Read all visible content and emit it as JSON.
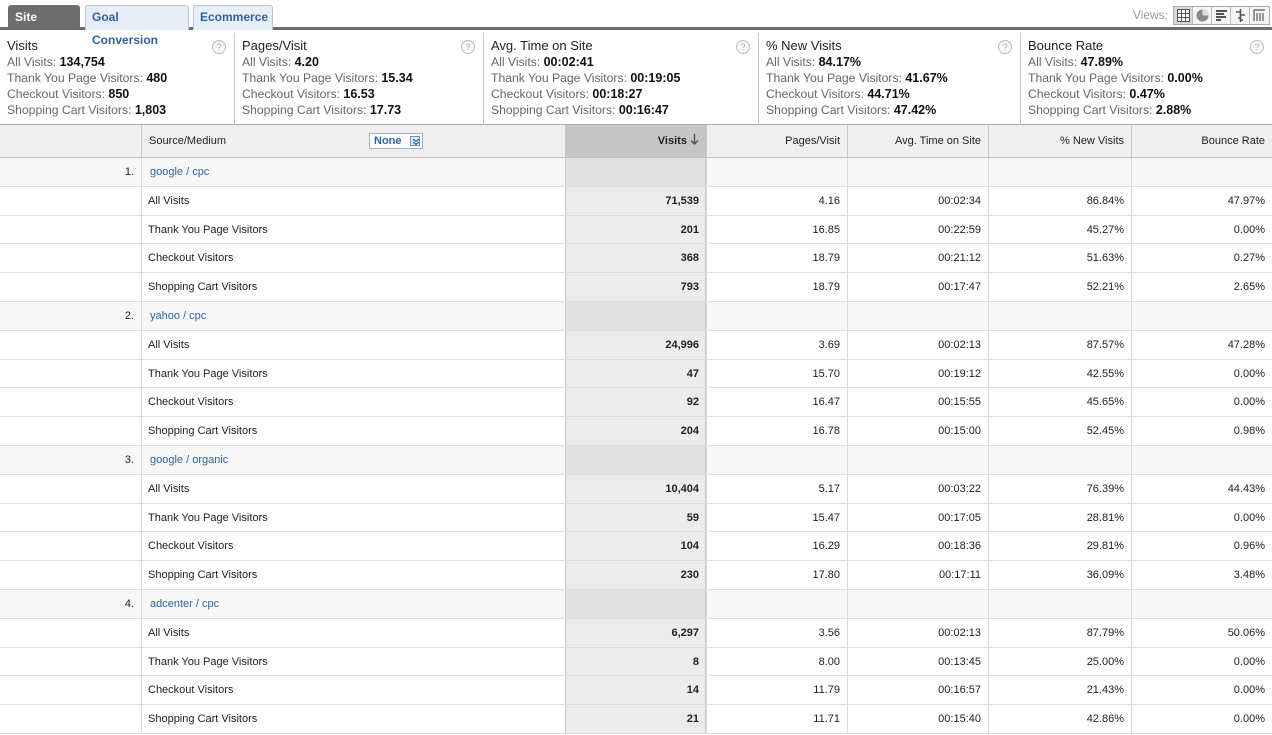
{
  "tabs": [
    "Site Usage",
    "Goal Conversion",
    "Ecommerce"
  ],
  "views_label": "Views:",
  "view_icons": [
    "table-view-icon",
    "pie-view-icon",
    "performance-view-icon",
    "comparison-view-icon",
    "pivot-view-icon"
  ],
  "summary": [
    {
      "title": "Visits",
      "lines": [
        [
          "All Visits:",
          "134,754"
        ],
        [
          "Thank You Page Visitors:",
          "480"
        ],
        [
          "Checkout Visitors:",
          "850"
        ],
        [
          "Shopping Cart Visitors:",
          "1,803"
        ]
      ]
    },
    {
      "title": "Pages/Visit",
      "lines": [
        [
          "All Visits:",
          "4.20"
        ],
        [
          "Thank You Page Visitors:",
          "15.34"
        ],
        [
          "Checkout Visitors:",
          "16.53"
        ],
        [
          "Shopping Cart Visitors:",
          "17.73"
        ]
      ]
    },
    {
      "title": "Avg. Time on Site",
      "lines": [
        [
          "All Visits:",
          "00:02:41"
        ],
        [
          "Thank You Page Visitors:",
          "00:19:05"
        ],
        [
          "Checkout Visitors:",
          "00:18:27"
        ],
        [
          "Shopping Cart Visitors:",
          "00:16:47"
        ]
      ]
    },
    {
      "title": "% New Visits",
      "lines": [
        [
          "All Visits:",
          "84.17%"
        ],
        [
          "Thank You Page Visitors:",
          "41.67%"
        ],
        [
          "Checkout Visitors:",
          "44.71%"
        ],
        [
          "Shopping Cart Visitors:",
          "47.42%"
        ]
      ]
    },
    {
      "title": "Bounce Rate",
      "lines": [
        [
          "All Visits:",
          "47.89%"
        ],
        [
          "Thank You Page Visitors:",
          "0.00%"
        ],
        [
          "Checkout Visitors:",
          "0.47%"
        ],
        [
          "Shopping Cart Visitors:",
          "2.88%"
        ]
      ]
    }
  ],
  "help_glyph": "?",
  "table": {
    "headers": {
      "source": "Source/Medium",
      "segment": "None",
      "visits": "Visits",
      "pages": "Pages/Visit",
      "time": "Avg. Time on Site",
      "newv": "% New Visits",
      "bounce": "Bounce Rate"
    },
    "groups": [
      {
        "rank": "1.",
        "name": "google / cpc",
        "rows": [
          [
            "All Visits",
            "71,539",
            "4.16",
            "00:02:34",
            "86.84%",
            "47.97%"
          ],
          [
            "Thank You Page Visitors",
            "201",
            "16.85",
            "00:22:59",
            "45.27%",
            "0.00%"
          ],
          [
            "Checkout Visitors",
            "368",
            "18.79",
            "00:21:12",
            "51.63%",
            "0.27%"
          ],
          [
            "Shopping Cart Visitors",
            "793",
            "18.79",
            "00:17:47",
            "52.21%",
            "2.65%"
          ]
        ]
      },
      {
        "rank": "2.",
        "name": "yahoo / cpc",
        "rows": [
          [
            "All Visits",
            "24,996",
            "3.69",
            "00:02:13",
            "87.57%",
            "47.28%"
          ],
          [
            "Thank You Page Visitors",
            "47",
            "15.70",
            "00:19:12",
            "42.55%",
            "0.00%"
          ],
          [
            "Checkout Visitors",
            "92",
            "16.47",
            "00:15:55",
            "45.65%",
            "0.00%"
          ],
          [
            "Shopping Cart Visitors",
            "204",
            "16.78",
            "00:15:00",
            "52.45%",
            "0.98%"
          ]
        ]
      },
      {
        "rank": "3.",
        "name": "google / organic",
        "rows": [
          [
            "All Visits",
            "10,404",
            "5.17",
            "00:03:22",
            "76.39%",
            "44.43%"
          ],
          [
            "Thank You Page Visitors",
            "59",
            "15.47",
            "00:17:05",
            "28.81%",
            "0.00%"
          ],
          [
            "Checkout Visitors",
            "104",
            "16.29",
            "00:18:36",
            "29.81%",
            "0.96%"
          ],
          [
            "Shopping Cart Visitors",
            "230",
            "17.80",
            "00:17:11",
            "36.09%",
            "3.48%"
          ]
        ]
      },
      {
        "rank": "4.",
        "name": "adcenter / cpc",
        "rows": [
          [
            "All Visits",
            "6,297",
            "3.56",
            "00:02:13",
            "87.79%",
            "50.06%"
          ],
          [
            "Thank You Page Visitors",
            "8",
            "8.00",
            "00:13:45",
            "25.00%",
            "0.00%"
          ],
          [
            "Checkout Visitors",
            "14",
            "11.79",
            "00:16:57",
            "21.43%",
            "0.00%"
          ],
          [
            "Shopping Cart Visitors",
            "21",
            "11.71",
            "00:15:40",
            "42.86%",
            "0.00%"
          ]
        ]
      }
    ]
  }
}
